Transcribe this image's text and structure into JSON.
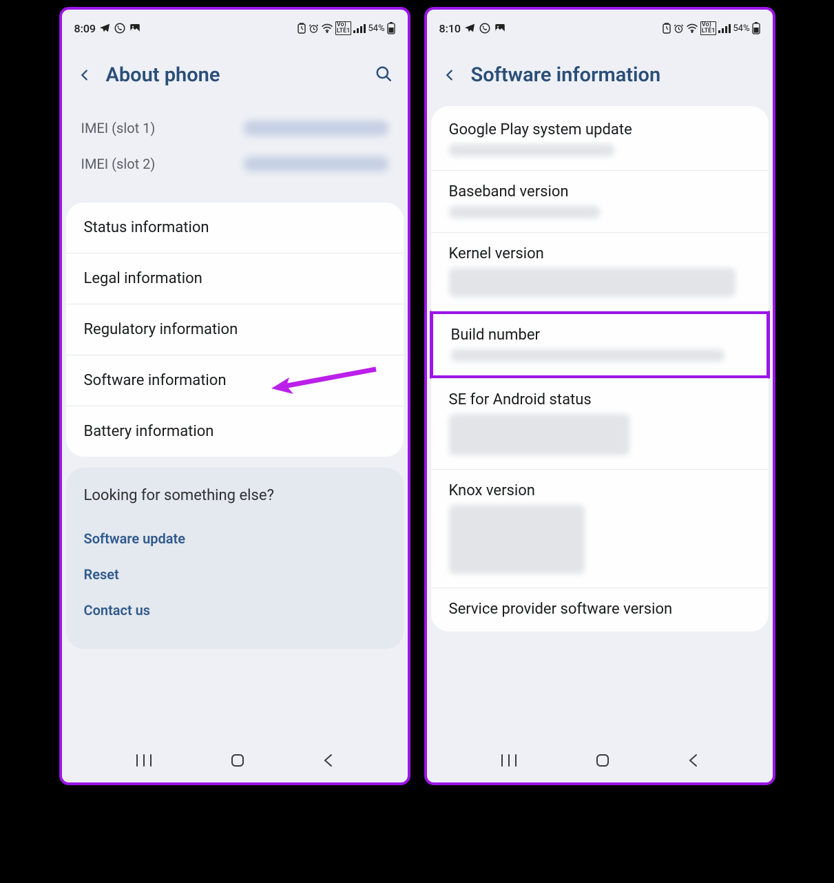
{
  "left": {
    "status": {
      "time": "8:09",
      "battery": "54%"
    },
    "header": {
      "title": "About phone"
    },
    "imei": [
      {
        "label": "IMEI (slot 1)"
      },
      {
        "label": "IMEI (slot 2)"
      }
    ],
    "items": [
      {
        "label": "Status information"
      },
      {
        "label": "Legal information"
      },
      {
        "label": "Regulatory information"
      },
      {
        "label": "Software information"
      },
      {
        "label": "Battery information"
      }
    ],
    "suggest": {
      "title": "Looking for something else?",
      "links": [
        {
          "label": "Software update"
        },
        {
          "label": "Reset"
        },
        {
          "label": "Contact us"
        }
      ]
    }
  },
  "right": {
    "status": {
      "time": "8:10",
      "battery": "54%"
    },
    "header": {
      "title": "Software information"
    },
    "items": [
      {
        "label": "Google Play system update",
        "sub": "short"
      },
      {
        "label": "Baseband version",
        "sub": "short"
      },
      {
        "label": "Kernel version",
        "sub": "tall"
      },
      {
        "label": "Build number",
        "sub": "short",
        "highlight": true
      },
      {
        "label": "SE for Android status",
        "sub": "tall"
      },
      {
        "label": "Knox version",
        "sub": "taller"
      },
      {
        "label": "Service provider software version",
        "sub": "short"
      }
    ]
  }
}
